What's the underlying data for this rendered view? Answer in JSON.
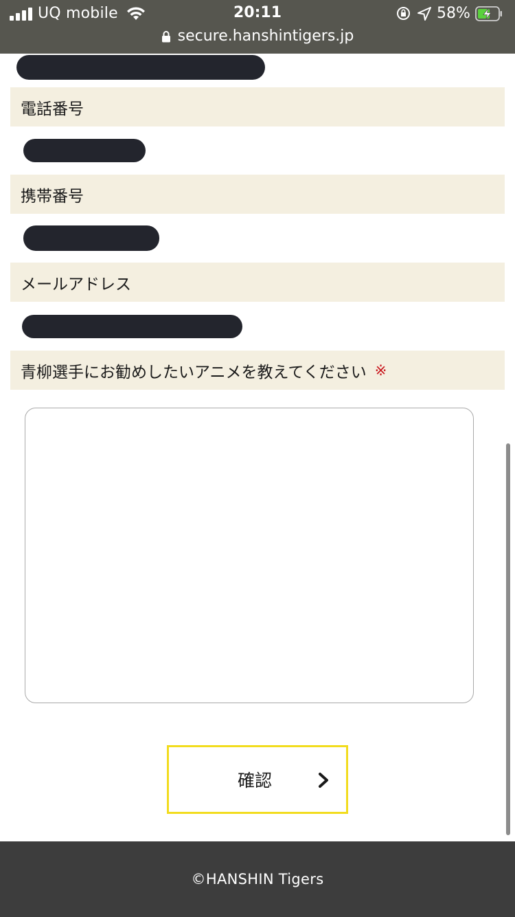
{
  "status_bar": {
    "carrier": "UQ mobile",
    "time": "20:11",
    "battery_percent": "58%"
  },
  "browser": {
    "url": "secure.hanshintigers.jp"
  },
  "form": {
    "phone_label": "電話番号",
    "mobile_label": "携帯番号",
    "email_label": "メールアドレス",
    "question_label": "青柳選手にお勧めしたいアニメを教えてください",
    "required_mark": "※",
    "answer_value": ""
  },
  "confirm_button": {
    "label": "確認"
  },
  "footer": {
    "copyright": "©HANSHIN Tigers"
  },
  "colors": {
    "chrome_bg": "#56564f",
    "label_bg": "#f4efe0",
    "required": "#c9171e",
    "button_border": "#f2dc1e",
    "footer_bg": "#3d3d3d"
  }
}
